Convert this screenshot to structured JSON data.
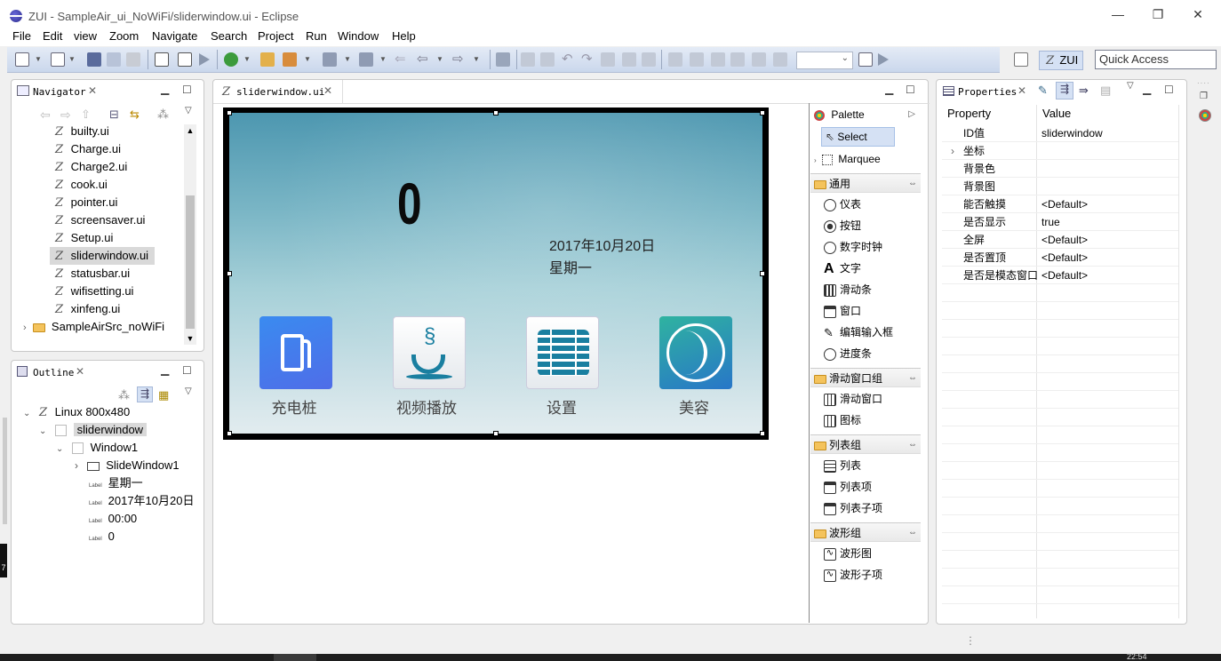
{
  "window": {
    "title": "ZUI - SampleAir_ui_NoWiFi/sliderwindow.ui - Eclipse",
    "minimize_glyph": "—",
    "maximize_glyph": "❐",
    "close_glyph": "✕"
  },
  "menu": [
    "File",
    "Edit",
    "view",
    "Zoom",
    "Navigate",
    "Search",
    "Project",
    "Run",
    "Window",
    "Help"
  ],
  "toolbar": {
    "zui_label": "ZUI",
    "quick_access": "Quick Access"
  },
  "navigator": {
    "tab": "Navigator",
    "files": [
      "builty.ui",
      "Charge.ui",
      "Charge2.ui",
      "cook.ui",
      "pointer.ui",
      "screensaver.ui",
      "Setup.ui",
      "sliderwindow.ui",
      "statusbar.ui",
      "wifisetting.ui",
      "xinfeng.ui"
    ],
    "project": "SampleAirSrc_noWiFi"
  },
  "outline": {
    "tab": "Outline",
    "root": "Linux 800x480",
    "sliderwindow": "sliderwindow",
    "window1": "Window1",
    "slidewindow1": "SlideWindow1",
    "label_tag": "Label",
    "labels": [
      "星期一",
      "2017年10月20日",
      "00:00",
      "0"
    ]
  },
  "editor": {
    "tab": "sliderwindow.ui",
    "big_number": "0",
    "date": "2017年10月20日",
    "weekday": "星期一",
    "apps": [
      {
        "label": "充电桩",
        "icon": "fuel-pump-icon"
      },
      {
        "label": "视频播放",
        "icon": "coffee-cup-icon"
      },
      {
        "label": "设置",
        "icon": "settings-list-icon"
      },
      {
        "label": "美容",
        "icon": "face-profile-icon"
      }
    ]
  },
  "palette": {
    "title": "Palette",
    "select": "Select",
    "marquee": "Marquee",
    "groups": [
      {
        "name": "通用",
        "items": [
          "仪表",
          "按钮",
          "数字时钟",
          "文字",
          "滑动条",
          "窗口",
          "编辑输入框",
          "进度条"
        ]
      },
      {
        "name": "滑动窗口组",
        "items": [
          "滑动窗口",
          "图标"
        ]
      },
      {
        "name": "列表组",
        "items": [
          "列表",
          "列表项",
          "列表子项"
        ]
      },
      {
        "name": "波形组",
        "items": [
          "波形图",
          "波形子项"
        ]
      }
    ]
  },
  "properties": {
    "tab": "Properties",
    "col_property": "Property",
    "col_value": "Value",
    "rows": [
      {
        "name": "ID值",
        "value": "sliderwindow"
      },
      {
        "name": "坐标",
        "value": ""
      },
      {
        "name": "背景色",
        "value": ""
      },
      {
        "name": "背景图",
        "value": ""
      },
      {
        "name": "能否触摸",
        "value": "<Default>"
      },
      {
        "name": "是否显示",
        "value": "true"
      },
      {
        "name": "全屏",
        "value": "<Default>"
      },
      {
        "name": "是否置顶",
        "value": "<Default>"
      },
      {
        "name": "是否是模态窗口",
        "value": "<Default>"
      }
    ]
  },
  "status": {
    "time_partial": "22:54",
    "left_digit": "7"
  }
}
